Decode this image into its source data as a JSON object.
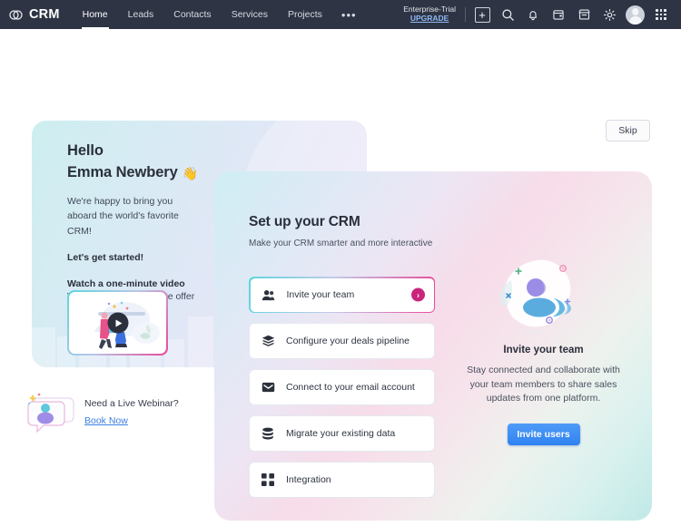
{
  "navbar": {
    "logo_text": "CRM",
    "logo_icon": "interlocking-rings-icon",
    "links": [
      {
        "label": "Home",
        "active": true
      },
      {
        "label": "Leads",
        "active": false
      },
      {
        "label": "Contacts",
        "active": false
      },
      {
        "label": "Services",
        "active": false
      },
      {
        "label": "Projects",
        "active": false
      }
    ],
    "more_label": "•••",
    "trial_label": "Enterprise-Trial",
    "upgrade_label": "UPGRADE",
    "icons": [
      "plus-icon",
      "search-icon",
      "bell-icon",
      "calendar-icon",
      "store-icon",
      "gear-icon",
      "avatar-icon",
      "apps-grid-icon"
    ]
  },
  "skip": {
    "label": "Skip"
  },
  "hello_card": {
    "greeting": "Hello",
    "name": "Emma Newbery",
    "wave_emoji": "👋",
    "paragraph": "We're happy to bring you aboard the world's favorite CRM!",
    "cta_bold": "Let's get started!",
    "watch_title": "Watch a one-minute video",
    "watch_sub": "View the key features we offer",
    "video_play_icon": "play-icon"
  },
  "webinar": {
    "title": "Need a Live Webinar?",
    "link": "Book Now",
    "icon": "chat-bubble-icon"
  },
  "setup_card": {
    "title": "Set up your CRM",
    "subtitle": "Make your CRM smarter and more interactive",
    "items": [
      {
        "label": "Invite your team",
        "icon": "people-group-icon",
        "highlighted": true,
        "arrow": "›"
      },
      {
        "label": "Configure your deals pipeline",
        "icon": "layers-icon",
        "highlighted": false
      },
      {
        "label": "Connect to your email account",
        "icon": "envelope-icon",
        "highlighted": false
      },
      {
        "label": "Migrate your existing data",
        "icon": "database-icon",
        "highlighted": false
      },
      {
        "label": "Integration",
        "icon": "grid-squares-icon",
        "highlighted": false
      }
    ]
  },
  "promo": {
    "illustration": "team-people-blob-illustration",
    "title": "Invite your team",
    "description": "Stay connected and collaborate with your team members to share sales updates from one platform.",
    "button_label": "Invite users"
  },
  "colors": {
    "navbar_bg": "#2e3444",
    "accent_blue": "#3b82f0",
    "accent_magenta": "#c9257d",
    "link_blue": "#3b7fe0",
    "text_dark": "#2a2f3b"
  }
}
